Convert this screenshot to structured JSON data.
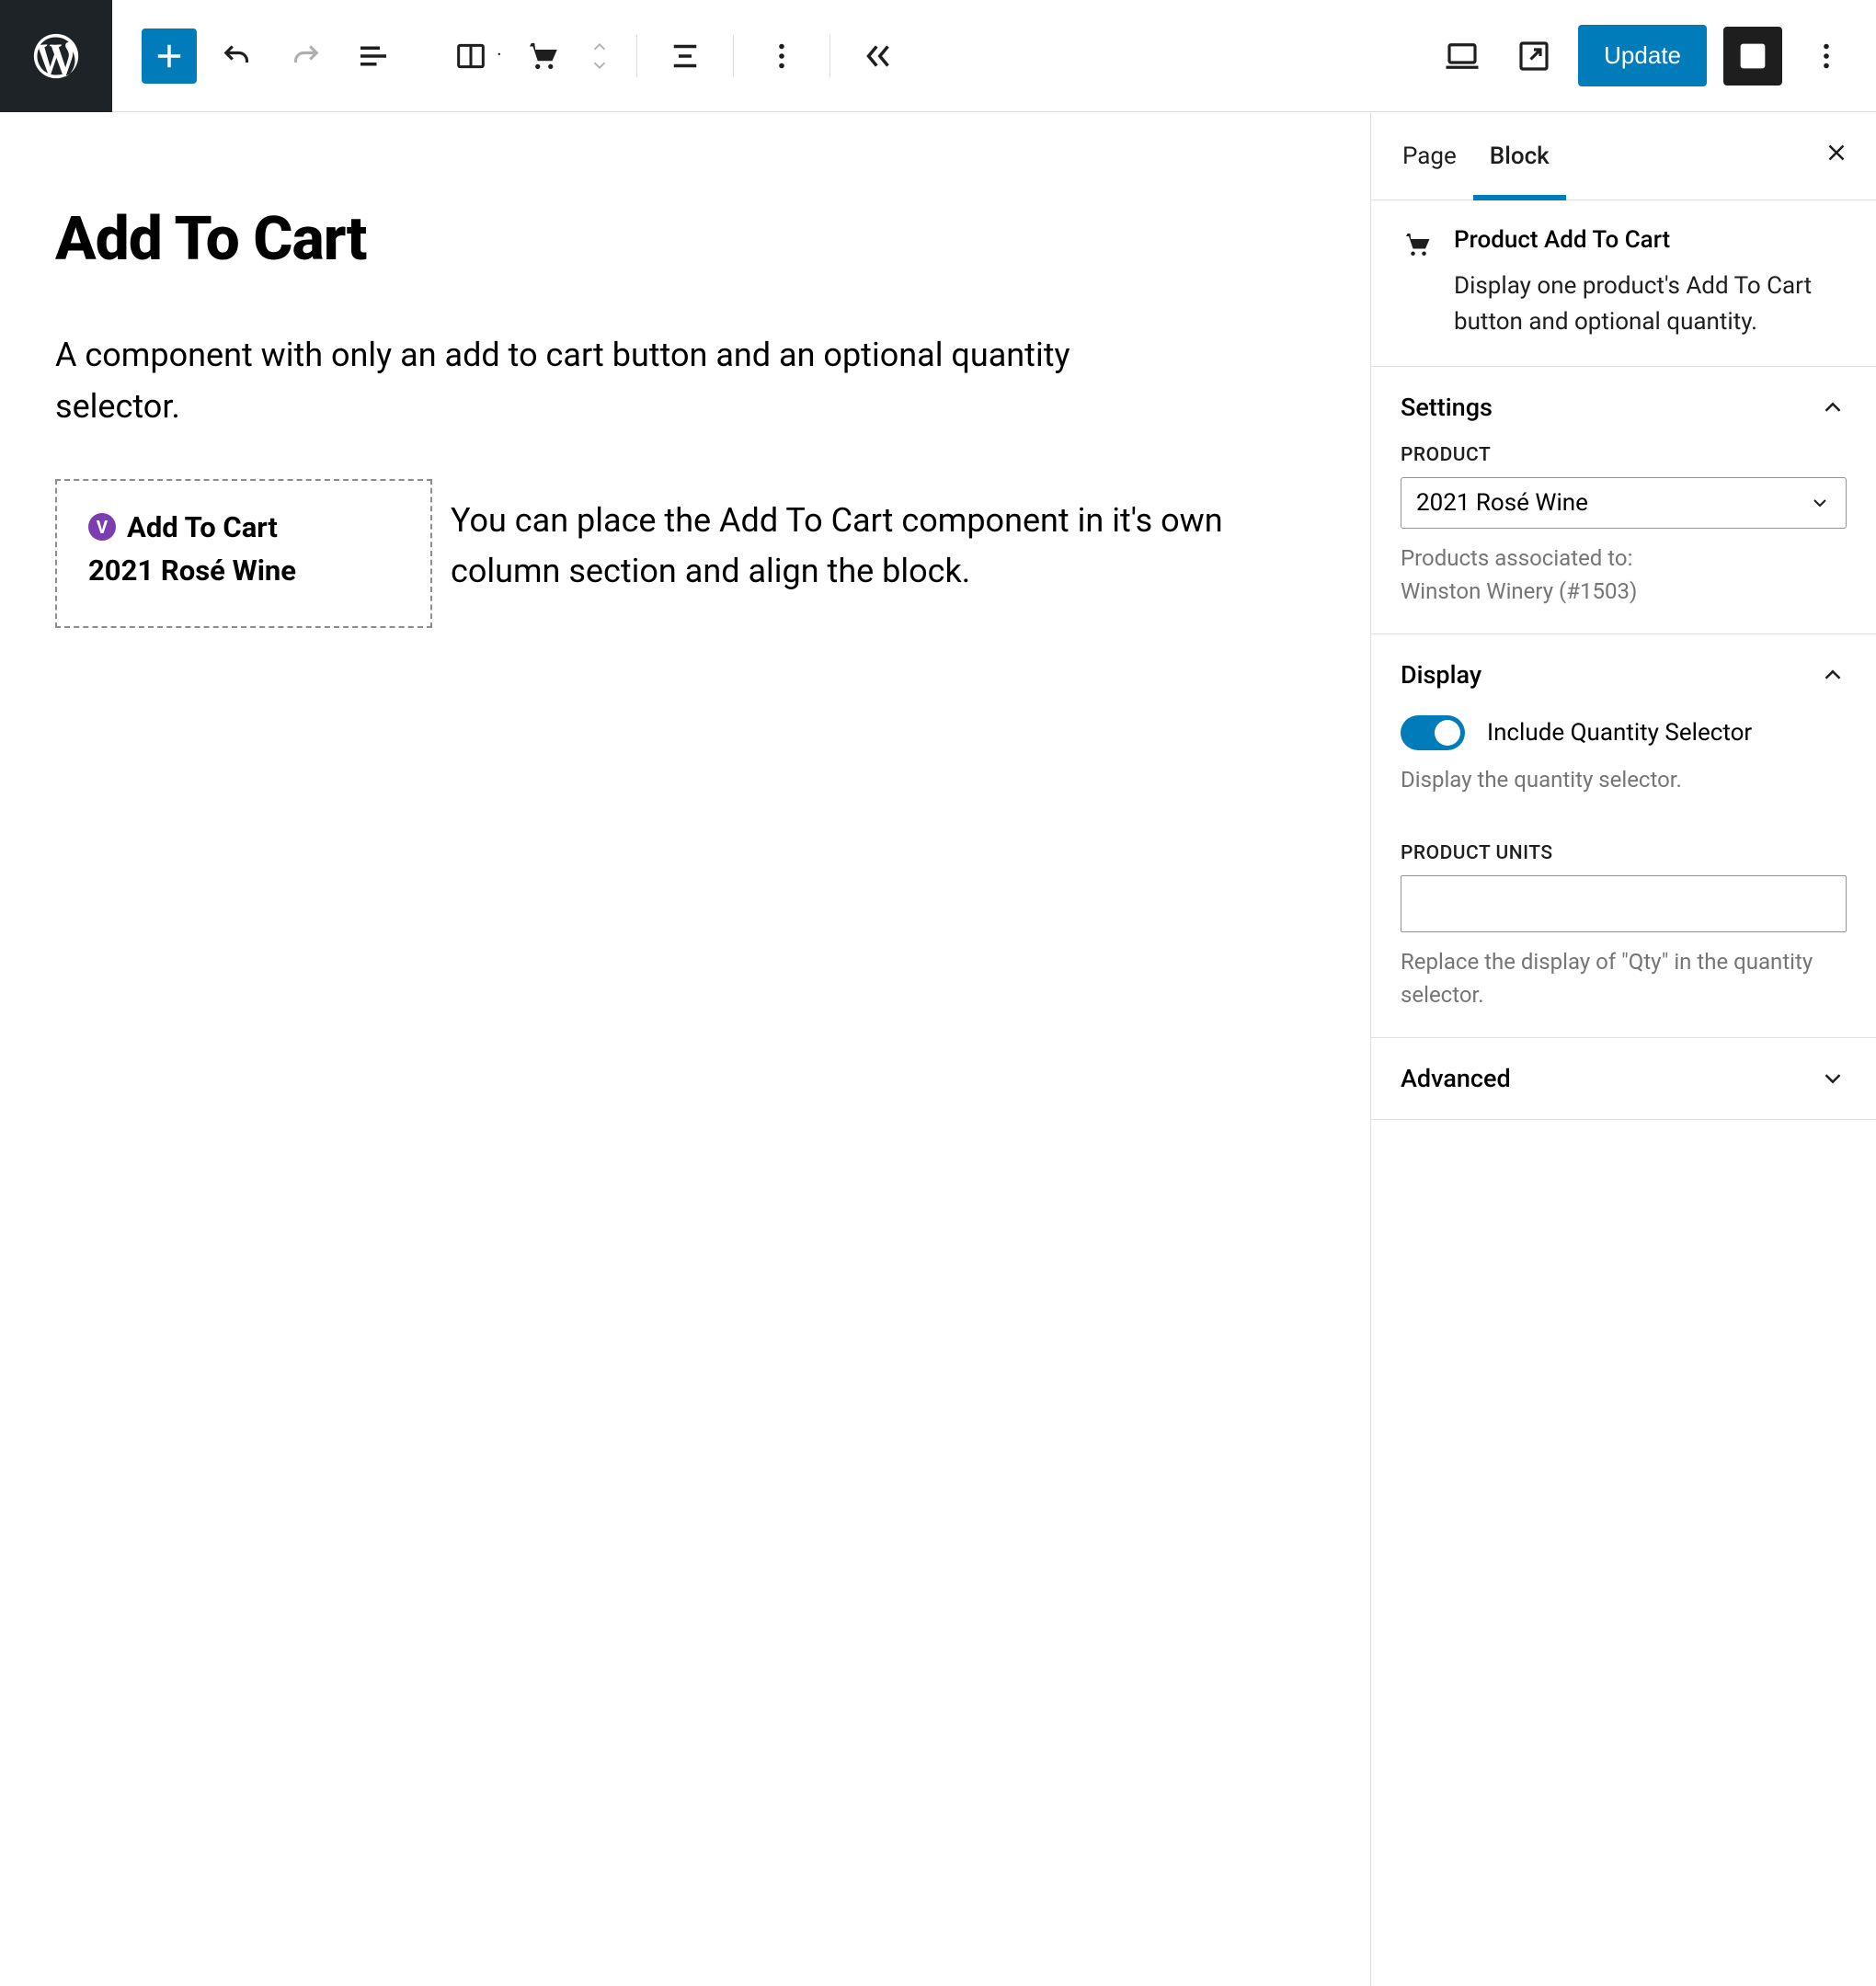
{
  "toolbar": {
    "update_label": "Update"
  },
  "canvas": {
    "title": "Add To Cart",
    "description": "A component with only an add to cart button and an optional quantity selector.",
    "block": {
      "badge": "V",
      "title": "Add To Cart",
      "subtitle": "2021 Rosé Wine"
    },
    "column_text": "You can place the Add To Cart component in it's own column section and align the block."
  },
  "sidebar": {
    "tabs": {
      "page": "Page",
      "block": "Block"
    },
    "block_info": {
      "title": "Product Add To Cart",
      "description": "Display one product's Add To Cart button and optional quantity."
    },
    "settings": {
      "heading": "Settings",
      "product_label": "PRODUCT",
      "product_value": "2021 Rosé Wine",
      "product_help": "Products associated to:\nWinston Winery (#1503)"
    },
    "display": {
      "heading": "Display",
      "toggle_label": "Include Quantity Selector",
      "toggle_help": "Display the quantity selector.",
      "units_label": "PRODUCT UNITS",
      "units_value": "",
      "units_help": "Replace the display of \"Qty\" in the quantity selector."
    },
    "advanced": {
      "heading": "Advanced"
    }
  }
}
